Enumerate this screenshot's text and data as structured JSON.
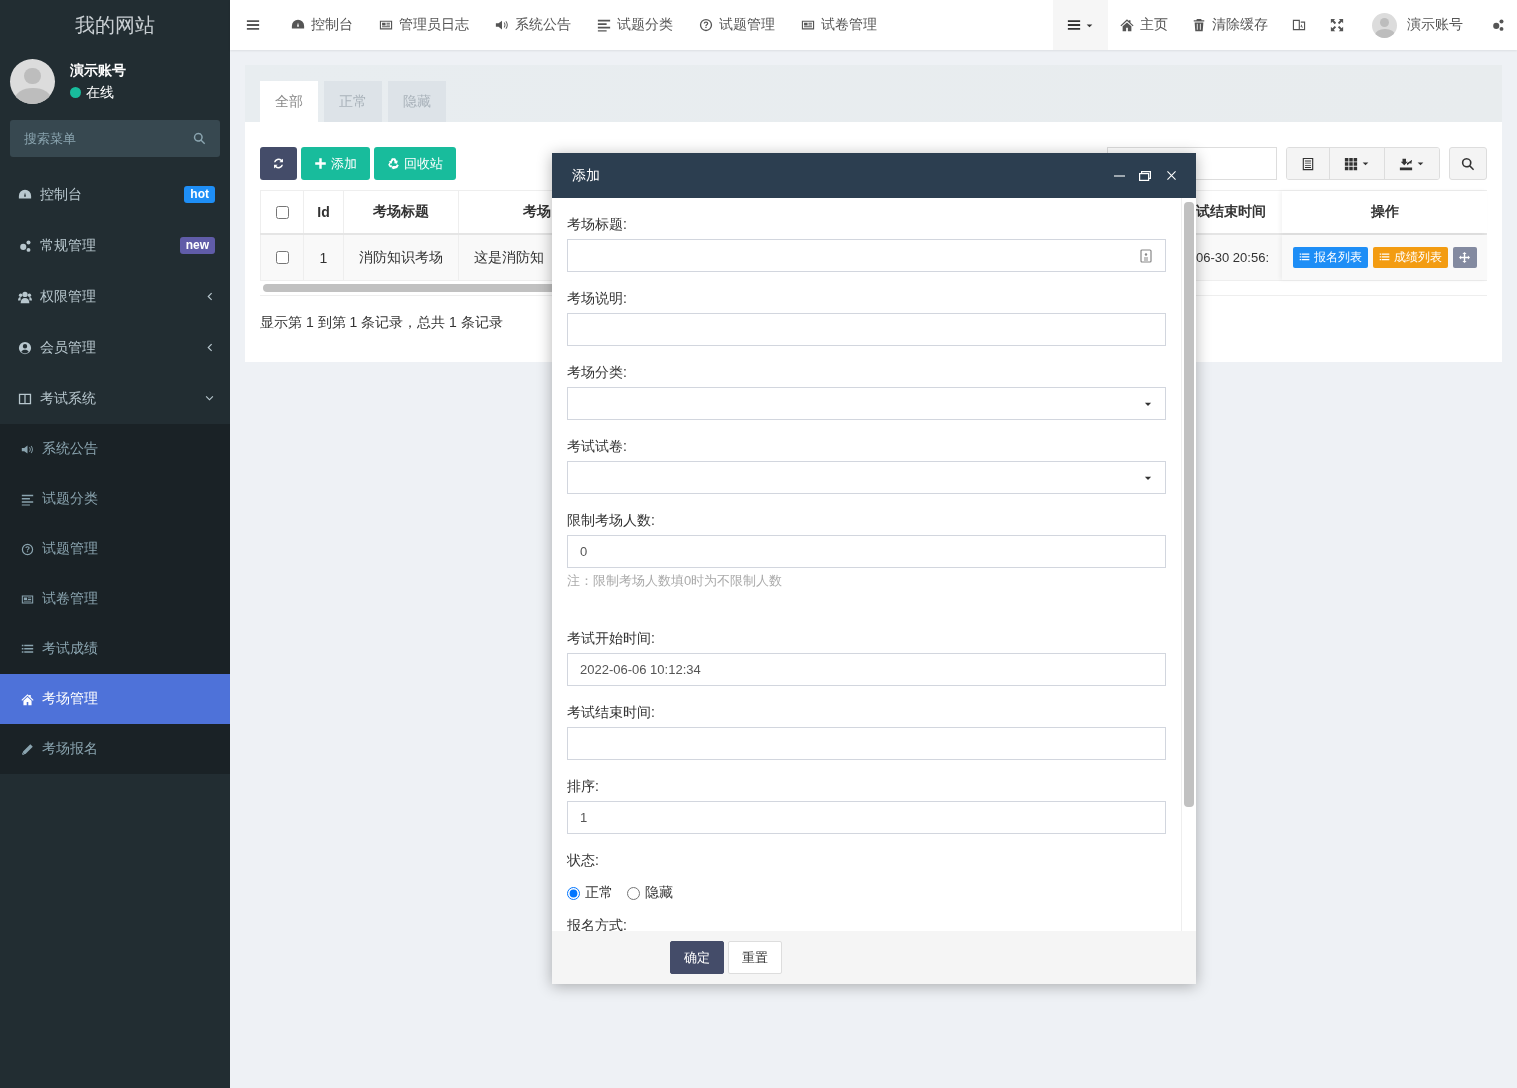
{
  "sidebar": {
    "logo": "我的网站",
    "user": {
      "name": "演示账号",
      "status": "在线",
      "online": true
    },
    "search": {
      "placeholder": "搜索菜单"
    },
    "items": [
      {
        "label": "控制台",
        "badge": {
          "text": "hot",
          "color": "#1e8ef6"
        },
        "selected": false
      },
      {
        "label": "常规管理",
        "badge": {
          "text": "new",
          "color": "#605ca8"
        },
        "selected": false
      },
      {
        "label": "权限管理",
        "expanded": false,
        "selected": false
      },
      {
        "label": "会员管理",
        "expanded": false,
        "selected": false
      },
      {
        "label": "考试系统",
        "expanded": true,
        "selected": false,
        "children": [
          {
            "label": "系统公告",
            "selected": false
          },
          {
            "label": "试题分类",
            "selected": false
          },
          {
            "label": "试题管理",
            "selected": false
          },
          {
            "label": "试卷管理",
            "selected": false
          },
          {
            "label": "考试成绩",
            "selected": false
          },
          {
            "label": "考场管理",
            "selected": true
          },
          {
            "label": "考场报名",
            "selected": false
          }
        ]
      }
    ]
  },
  "header": {
    "nav": [
      "控制台",
      "管理员日志",
      "系统公告",
      "试题分类",
      "试题管理",
      "试卷管理"
    ],
    "right": [
      {
        "kind": "menu"
      },
      {
        "kind": "home",
        "label": "主页"
      },
      {
        "kind": "trash",
        "label": "清除缓存"
      },
      {
        "kind": "translate"
      },
      {
        "kind": "fullscreen"
      },
      {
        "kind": "user",
        "label": "演示账号"
      },
      {
        "kind": "settings"
      }
    ]
  },
  "tabs": [
    {
      "label": "全部",
      "selected": true
    },
    {
      "label": "正常",
      "selected": false
    },
    {
      "label": "隐藏",
      "selected": false
    }
  ],
  "toolbar": {
    "buttons": [
      {
        "kind": "refresh"
      },
      {
        "kind": "add",
        "label": "添加"
      },
      {
        "kind": "recycle",
        "label": "回收站"
      }
    ],
    "tools": [
      {
        "kind": "table",
        "caret": false
      },
      {
        "kind": "columns",
        "caret": true
      },
      {
        "kind": "export",
        "caret": true
      }
    ]
  },
  "table": {
    "columns": [
      "Id",
      "考场标题",
      "考场",
      "试结束时间",
      "操作"
    ],
    "all_checked": false,
    "rows": [
      {
        "checked": false,
        "cells": [
          "1",
          "消防知识考场",
          "这是消防知",
          "06-30 20:56:"
        ],
        "actions": [
          {
            "kind": "primary",
            "label": "报名列表"
          },
          {
            "kind": "warning",
            "label": "成绩列表"
          },
          {
            "kind": "move"
          }
        ]
      }
    ]
  },
  "pager": "显示第 1 到第 1 条记录，总共 1 条记录",
  "modal": {
    "title": "添加",
    "fields": [
      {
        "kind": "text",
        "label": "考场标题:",
        "icon": true
      },
      {
        "kind": "text",
        "label": "考场说明:"
      },
      {
        "kind": "select",
        "label": "考场分类:"
      },
      {
        "kind": "select",
        "label": "考试试卷:"
      },
      {
        "kind": "text",
        "label": "限制考场人数:",
        "value": "0",
        "hint": "注：限制考场人数填0时为不限制人数"
      },
      {
        "kind": "text",
        "label": "考试开始时间:",
        "value": "2022-06-06 10:12:34"
      },
      {
        "kind": "text",
        "label": "考试结束时间:"
      },
      {
        "kind": "text",
        "label": "排序:",
        "value": "1"
      },
      {
        "kind": "radio",
        "label": "状态:",
        "options": [
          {
            "label": "正常",
            "selected": true
          },
          {
            "label": "隐藏",
            "selected": false
          }
        ]
      },
      {
        "kind": "label",
        "label": "报名方式:"
      }
    ],
    "buttons": [
      {
        "kind": "submit",
        "label": "确定"
      },
      {
        "kind": "reset",
        "label": "重置"
      }
    ]
  }
}
